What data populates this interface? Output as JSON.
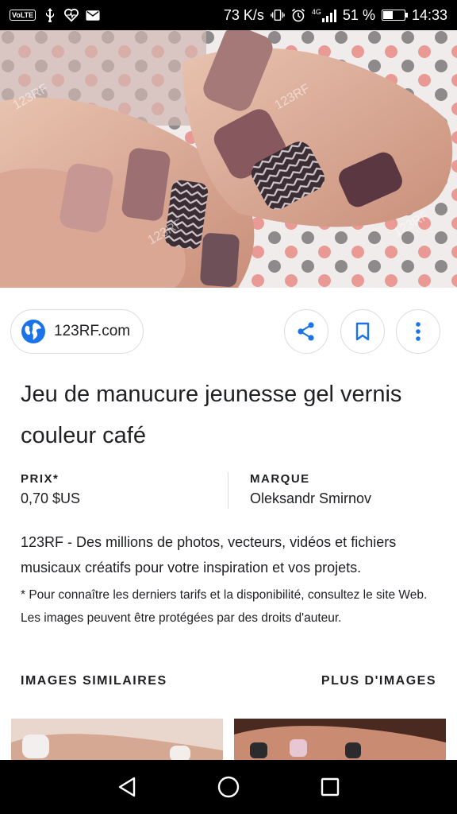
{
  "status_bar": {
    "volte": "VoLTE",
    "speed": "73 K/s",
    "network": "4G",
    "battery": "51 %",
    "battery_level": 0.51,
    "time": "14:33"
  },
  "source": {
    "site": "123RF.com",
    "actions": [
      "share",
      "bookmark",
      "more"
    ]
  },
  "title": "Jeu de manucure jeunesse gel vernis couleur café",
  "info": {
    "price_label": "PRIX*",
    "price_value": "0,70 $US",
    "brand_label": "MARQUE",
    "brand_value": "Oleksandr Smirnov"
  },
  "description": "123RF - Des millions de photos, vecteurs, vidéos et fichiers musicaux créatifs pour votre inspiration et vos projets.",
  "note": "* Pour connaître les derniers tarifs et la disponibilité, consultez le site Web. Les images peuvent être protégées par des droits d'auteur.",
  "similar": {
    "left_label": "IMAGES SIMILAIRES",
    "right_label": "PLUS D'IMAGES"
  },
  "colors": {
    "accent": "#1a73e8",
    "border": "#dadce0",
    "text": "#202124"
  }
}
